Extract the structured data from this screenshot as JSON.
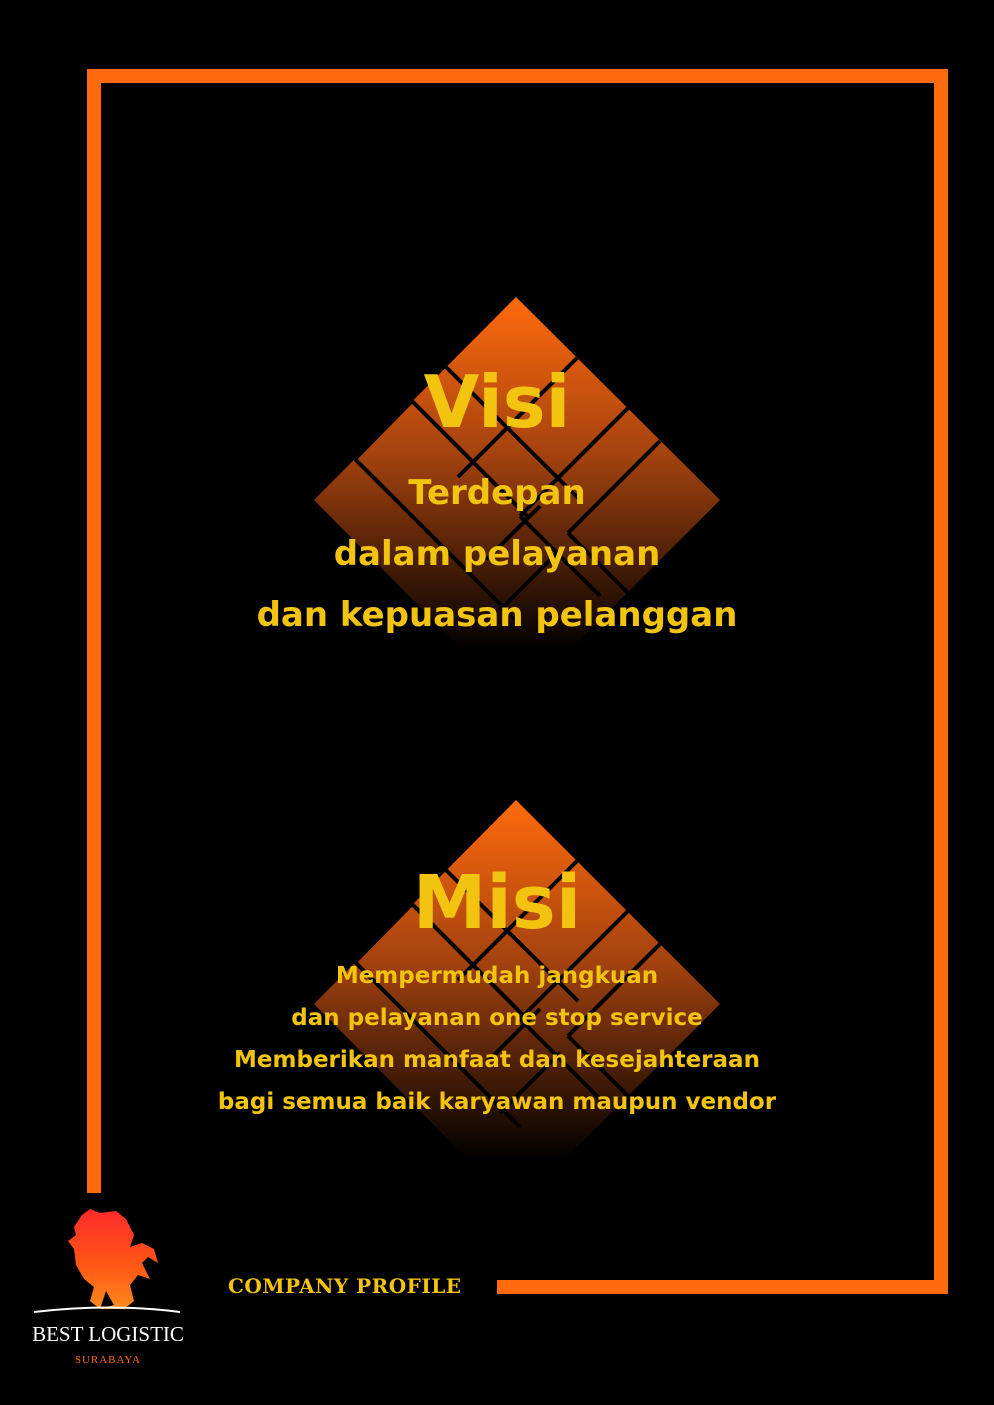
{
  "colors": {
    "accent": "#ff6a0d",
    "text": "#f2c40f",
    "background": "#000000"
  },
  "visi": {
    "title": "Visi",
    "lines": [
      "Terdepan",
      "dalam pelayanan",
      "dan kepuasan pelanggan"
    ]
  },
  "misi": {
    "title": "Misi",
    "lines": [
      "Mempermudah jangkuan",
      "dan pelayanan one stop service",
      "Memberikan manfaat dan kesejahteraan",
      "bagi semua baik karyawan maupun vendor"
    ]
  },
  "footer": {
    "label": "COMPANY PROFILE"
  },
  "logo": {
    "icon": "horse-icon",
    "name": "BEST LOGISTIC",
    "city": "SURABAYA"
  }
}
